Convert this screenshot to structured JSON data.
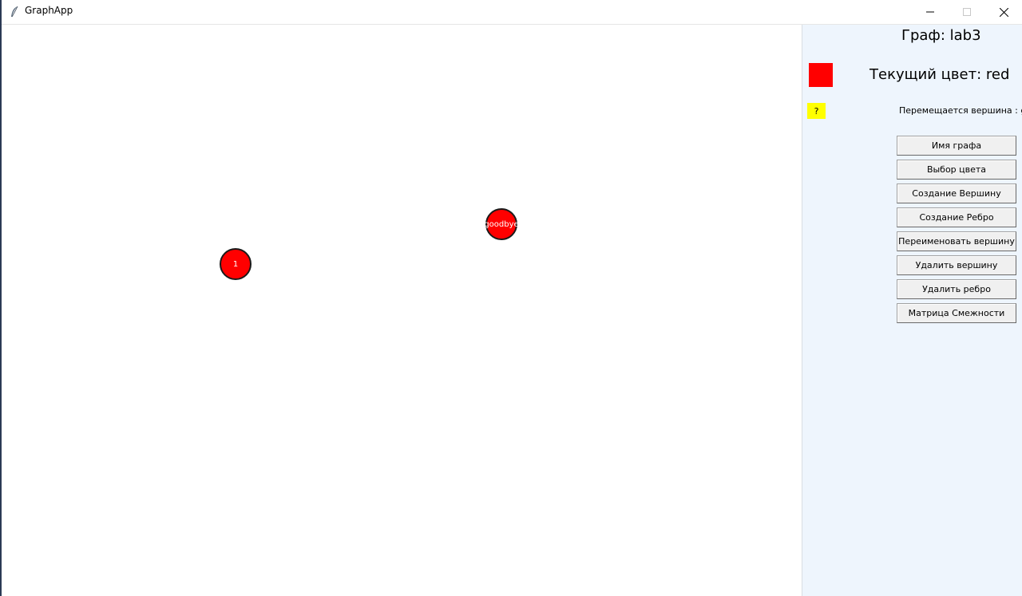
{
  "window": {
    "title": "GraphApp"
  },
  "canvas": {
    "vertices": [
      {
        "label": "1",
        "color": "#ff0000"
      },
      {
        "label": "goodbye",
        "color": "#ff0000"
      }
    ]
  },
  "panel": {
    "graph_title": "Граф: lab3",
    "current_color_label": "Текущий цвет: red",
    "current_color": "#ff0000",
    "help_label": "?",
    "status_text": "Перемещается вершина : goodbye",
    "buttons": [
      "Имя графа",
      "Выбор цвета",
      "Создание Вершину",
      "Создание Ребро",
      "Переименовать вершину",
      "Удалить вершину",
      "Удалить ребро",
      "Матрица Смежности"
    ]
  },
  "icons": {
    "app": "feather-icon",
    "minimize": "minimize-icon",
    "maximize": "maximize-icon",
    "close": "close-icon"
  }
}
